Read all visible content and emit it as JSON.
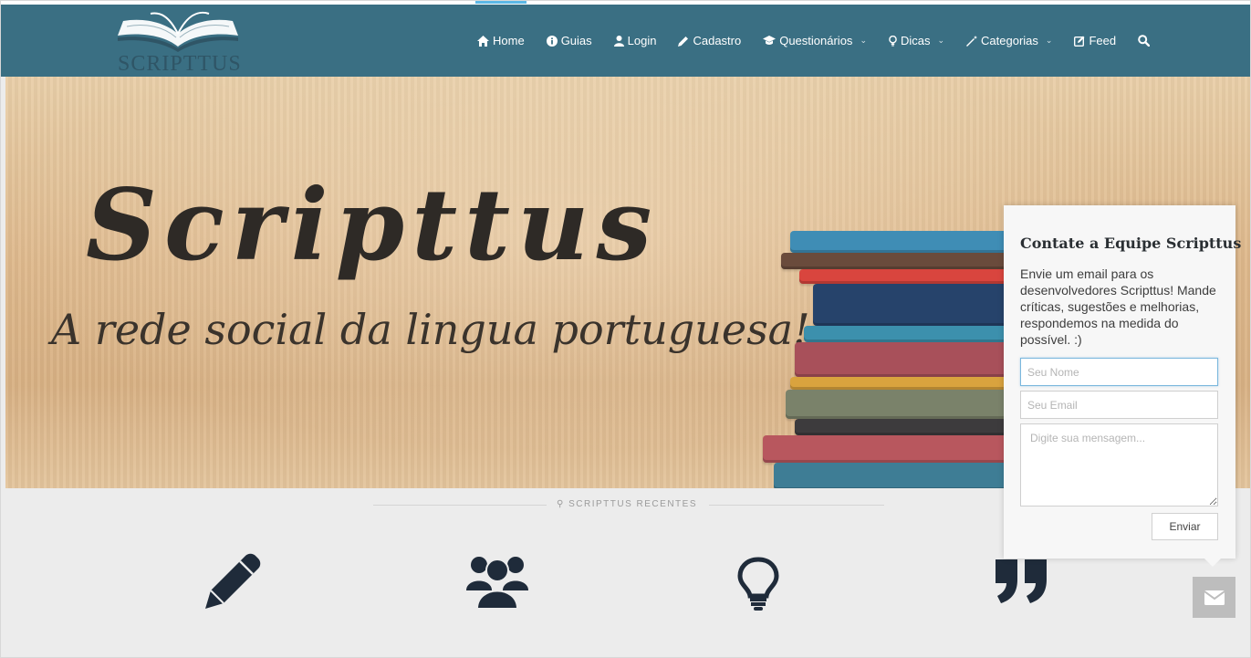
{
  "brand": {
    "logo_text": "SCRIPTTUS"
  },
  "nav": {
    "items": [
      {
        "label": "Home",
        "icon": "home-icon"
      },
      {
        "label": "Guias",
        "icon": "info-icon"
      },
      {
        "label": "Login",
        "icon": "user-icon"
      },
      {
        "label": "Cadastro",
        "icon": "pencil-icon"
      },
      {
        "label": "Questionários",
        "icon": "graduation-cap-icon"
      },
      {
        "label": "Dicas",
        "icon": "lightbulb-icon"
      },
      {
        "label": "Categorias",
        "icon": "magic-wand-icon"
      },
      {
        "label": "Feed",
        "icon": "edit-icon"
      }
    ]
  },
  "hero": {
    "title": "Scripttus",
    "subtitle": "A rede social da lingua portuguesa!"
  },
  "section": {
    "label": "SCRIPTTUS RECENTES"
  },
  "features": {
    "icons": [
      "pencil-icon",
      "users-icon",
      "lightbulb-icon",
      "quote-icon"
    ]
  },
  "contact": {
    "title": "Contate a Equipe Scripttus",
    "description": "Envie um email para os desenvolvedores Scripttus! Mande críticas, sugestões e melhorias, respondemos na medida do possível. :)",
    "name_placeholder": "Seu Nome",
    "email_placeholder": "Seu Email",
    "message_placeholder": "Digite sua mensagem...",
    "send_label": "Enviar"
  },
  "colors": {
    "navbar": "#3a6f83",
    "active_indicator": "#5cb8e6",
    "icon_dark": "#1f2b3a"
  }
}
